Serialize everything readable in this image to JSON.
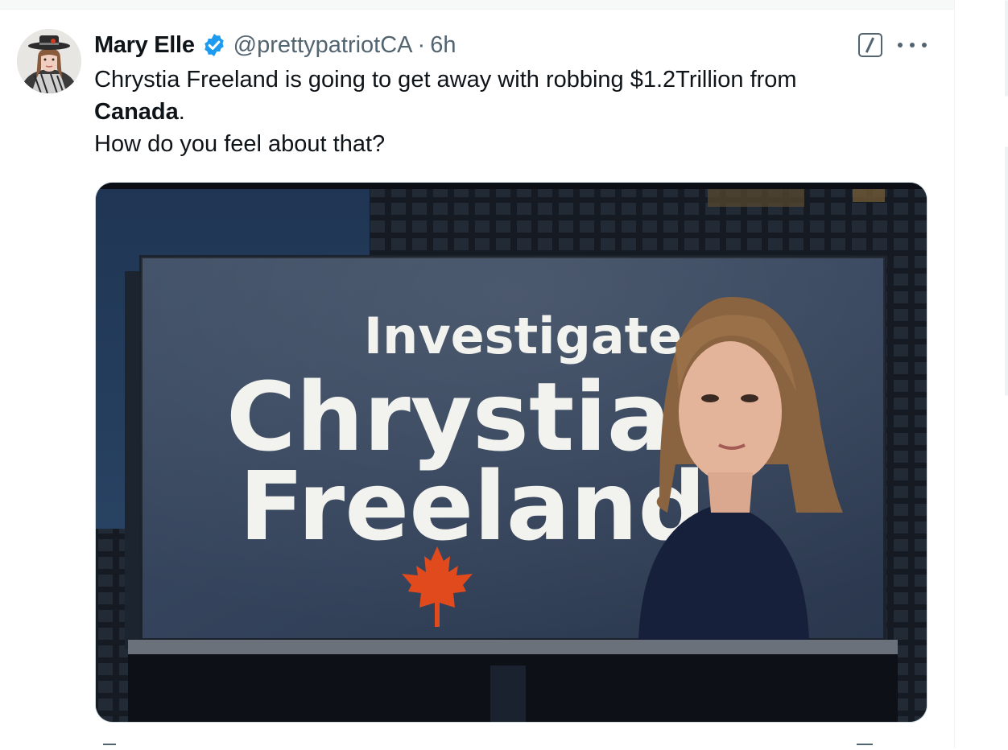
{
  "tweet": {
    "author_name": "Mary Elle",
    "verified": true,
    "handle": "@prettypatriotCA",
    "separator": "·",
    "time": "6h",
    "text_line1": "Chrystia Freeland is going to get away with robbing $1.2Trillion from",
    "text_line2_bold": "Canada",
    "text_line2_rest": ".",
    "text_line3": "How do you feel about that?"
  },
  "media": {
    "billboard_line1": "Investigate",
    "billboard_line2": "Chrystia",
    "billboard_line3": "Freeland"
  },
  "icons": {
    "verified": "verified-badge-icon",
    "grok": "grok-icon",
    "more": "more-dots-icon",
    "leaf": "maple-leaf-icon"
  },
  "colors": {
    "text": "#0f1419",
    "secondary": "#536471",
    "verified": "#1d9bf0",
    "border": "#cfd9de",
    "maple": "#e04a1c"
  }
}
